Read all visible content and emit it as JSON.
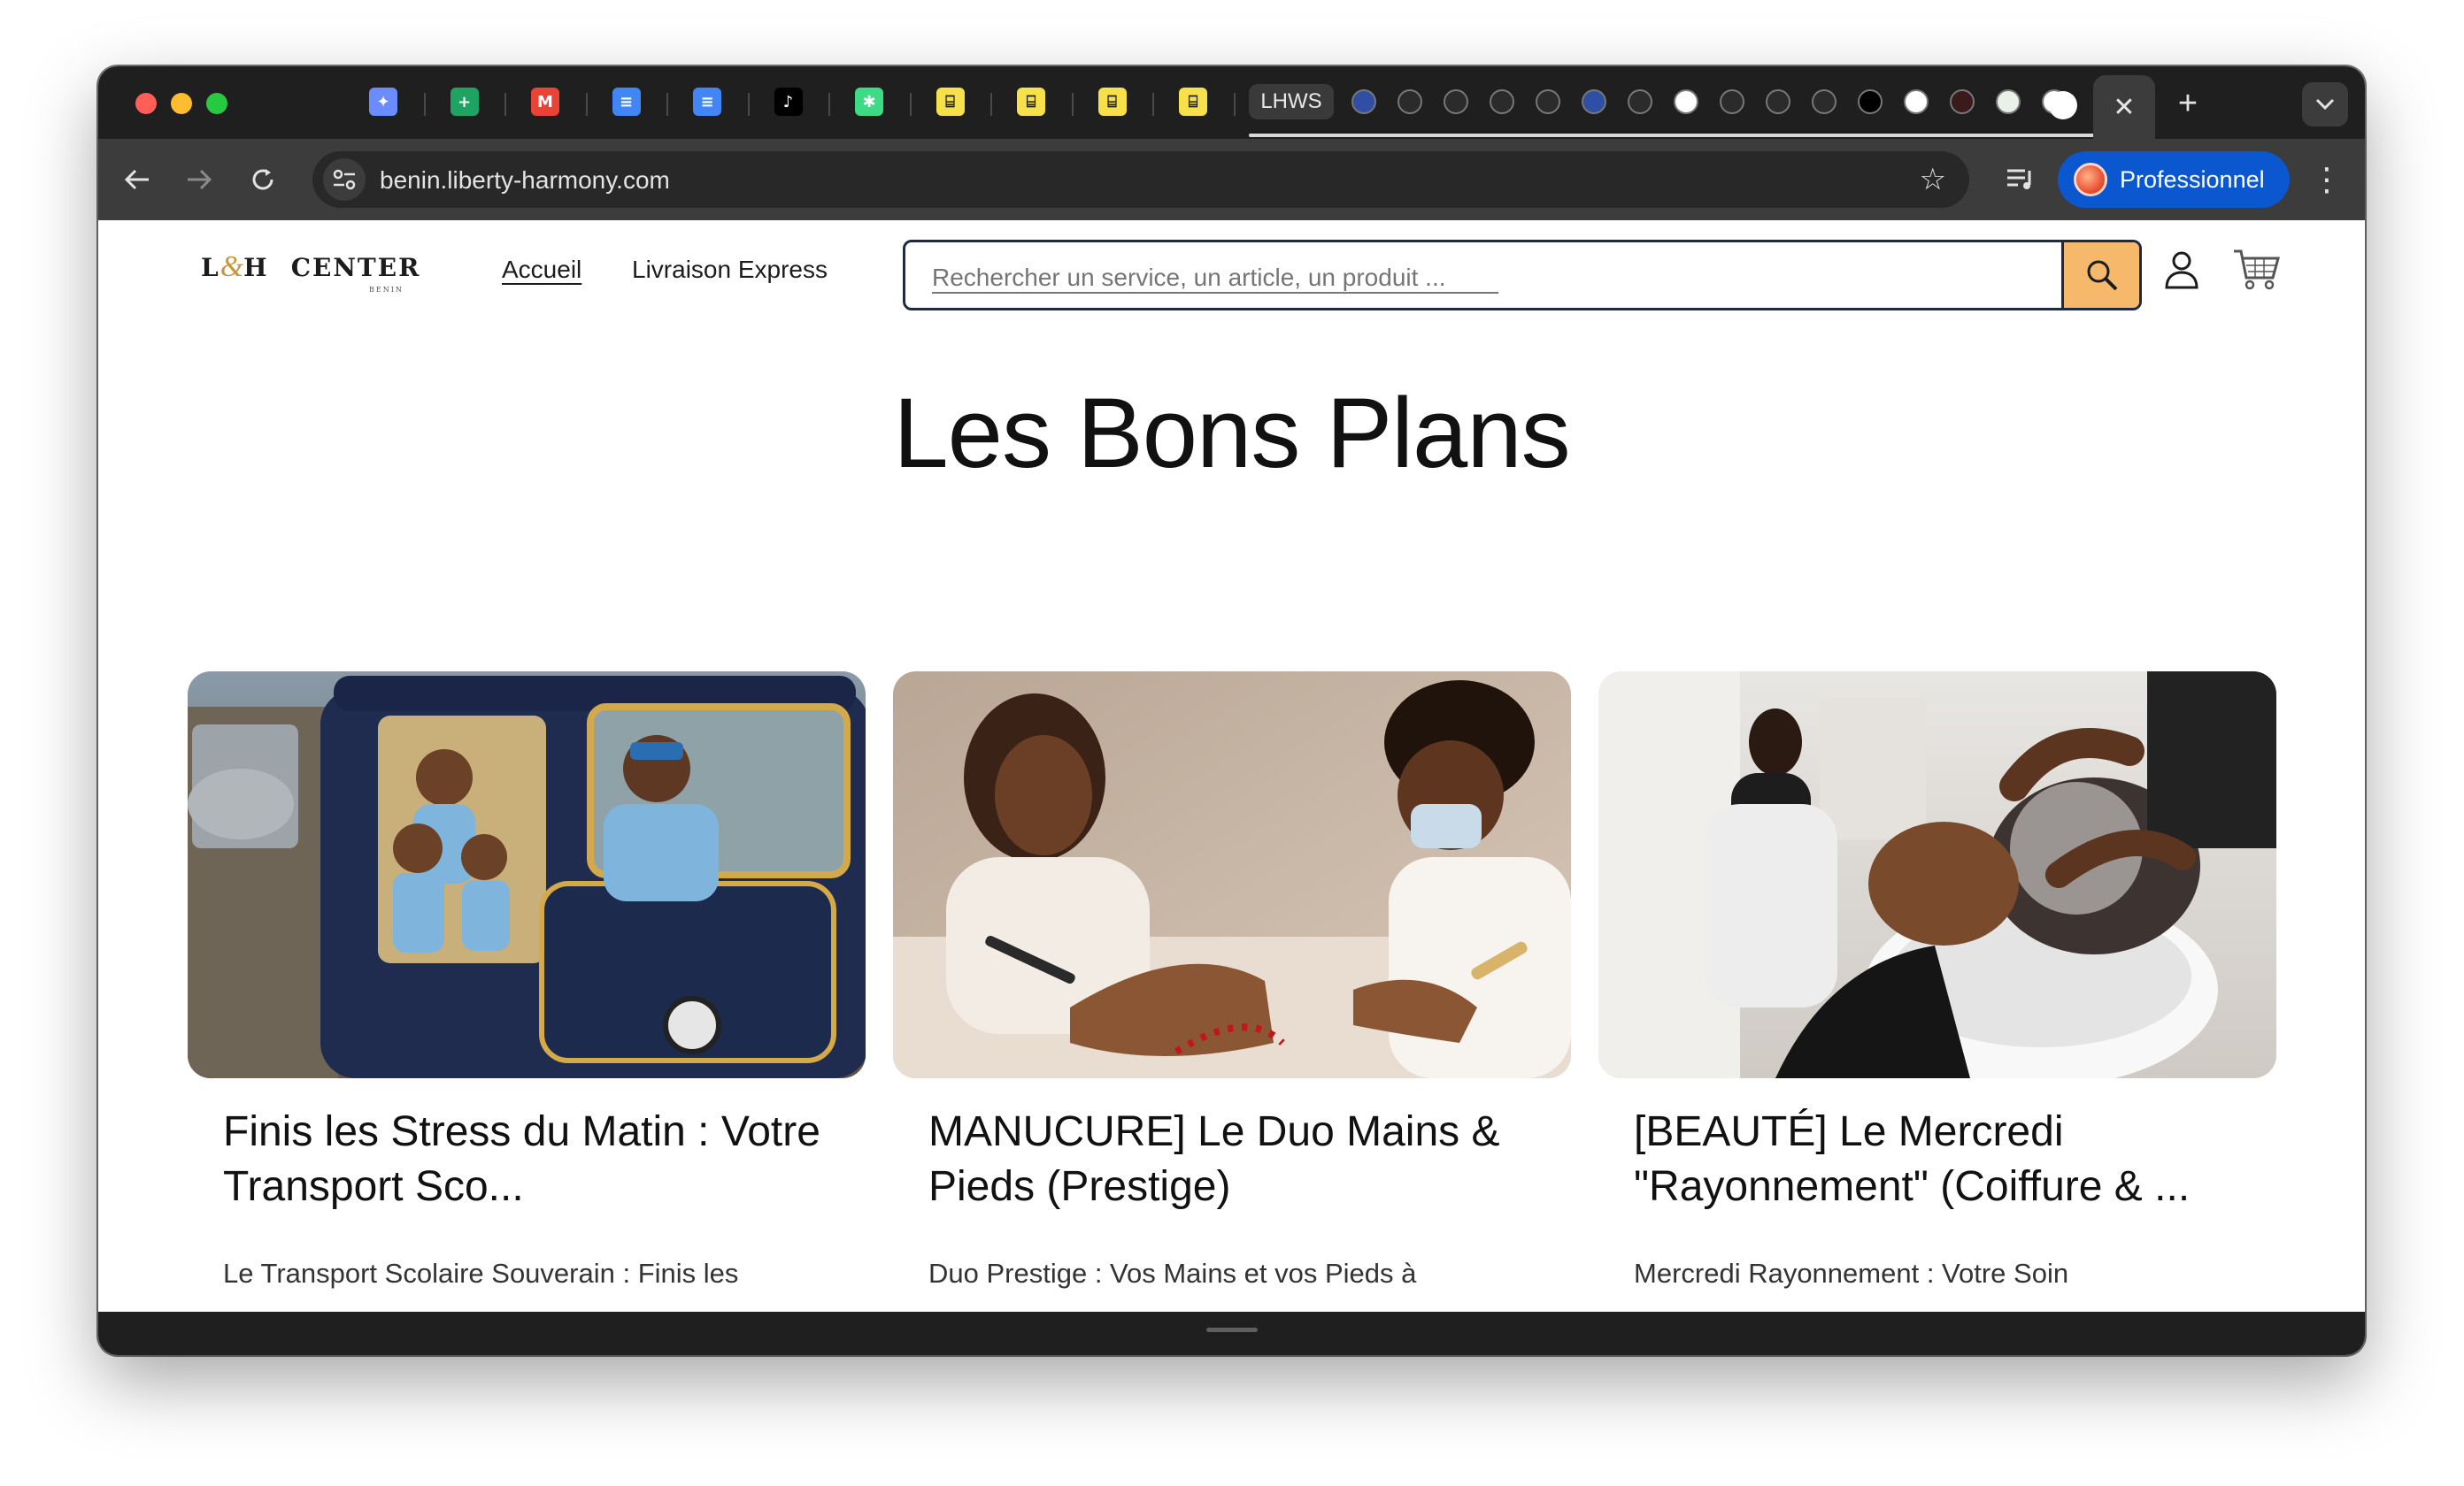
{
  "browser": {
    "tabs": [
      {
        "name": "gemini-tab",
        "icon": "sparkle-icon",
        "color": "#6b8cff",
        "glyph": "✦"
      },
      {
        "name": "sheets-tab",
        "icon": "google-sheets-icon",
        "color": "#1ea362",
        "glyph": "+"
      },
      {
        "name": "gmail-tab",
        "icon": "gmail-icon",
        "color": "#ea4335",
        "glyph": "M"
      },
      {
        "name": "docs-tab-1",
        "icon": "google-docs-icon",
        "color": "#4285f4",
        "glyph": "≡"
      },
      {
        "name": "docs-tab-2",
        "icon": "google-docs-icon",
        "color": "#4285f4",
        "glyph": "≡"
      },
      {
        "name": "tiktok-tab",
        "icon": "tiktok-icon",
        "color": "#000000",
        "glyph": "♪"
      },
      {
        "name": "app-tab",
        "icon": "asterisk-icon",
        "color": "#3ddc84",
        "glyph": "✱"
      },
      {
        "name": "yellow-tab-1",
        "icon": "yellow-app-icon",
        "color": "#f7e14b",
        "glyph": "⌸"
      },
      {
        "name": "yellow-tab-2",
        "icon": "yellow-app-icon",
        "color": "#f7e14b",
        "glyph": "⌸"
      },
      {
        "name": "yellow-tab-3",
        "icon": "yellow-app-icon",
        "color": "#f7e14b",
        "glyph": "⌸"
      },
      {
        "name": "yellow-tab-4",
        "icon": "yellow-app-icon",
        "color": "#f7e14b",
        "glyph": "⌸"
      },
      {
        "name": "yellow-tab-5",
        "icon": "yellow-app-icon",
        "color": "#f7e14b",
        "glyph": "⌸"
      }
    ],
    "group_label": "LHWS",
    "group_tabs": [
      {
        "name": "lh-tab-1",
        "icon": "globe-icon",
        "color": "#2e4fa3"
      },
      {
        "name": "lh-tab-2",
        "icon": "lh-logo-icon",
        "color": "#2b2b2b"
      },
      {
        "name": "lh-tab-3",
        "icon": "lh-logo-icon",
        "color": "#2b2b2b"
      },
      {
        "name": "lh-tab-4",
        "icon": "lh-logo-icon",
        "color": "#2b2b2b"
      },
      {
        "name": "lh-tab-5",
        "icon": "lh-logo-icon",
        "color": "#2b2b2b"
      },
      {
        "name": "lh-tab-6",
        "icon": "globe-icon",
        "color": "#2e4fa3"
      },
      {
        "name": "lh-tab-7",
        "icon": "lh-logo-icon",
        "color": "#2b2b2b"
      },
      {
        "name": "lh-tab-8",
        "icon": "lh-circle-icon",
        "color": "#ffffff"
      },
      {
        "name": "lh-tab-9",
        "icon": "lh-logo-icon",
        "color": "#2b2b2b"
      },
      {
        "name": "lh-tab-10",
        "icon": "lh-logo-icon",
        "color": "#2b2b2b"
      },
      {
        "name": "lh-tab-11",
        "icon": "lh-logo-icon",
        "color": "#2b2b2b"
      },
      {
        "name": "lh-tab-12",
        "icon": "b-logo-icon",
        "color": "#000000"
      },
      {
        "name": "lh-tab-13",
        "icon": "flower-icon",
        "color": "#ffffff"
      },
      {
        "name": "lh-tab-14",
        "icon": "dark-logo-icon",
        "color": "#3a1a1a"
      },
      {
        "name": "lh-tab-15",
        "icon": "picture-icon",
        "color": "#e8f0e8"
      },
      {
        "name": "lh-tab-16",
        "icon": "lh-circle-icon",
        "color": "#ffffff"
      }
    ],
    "active_tab_close": "✕",
    "new_tab": "+",
    "url": "benin.liberty-harmony.com",
    "profile_label": "Professionnel"
  },
  "site": {
    "logo": {
      "left": "L",
      "amp": "&",
      "right": "H",
      "word": "CENTER",
      "sub": "BENIN"
    },
    "nav": [
      {
        "label": "Accueil",
        "active": true
      },
      {
        "label": "Livraison Express",
        "active": false
      }
    ],
    "search_placeholder": "Rechercher un service, un article, un produit ...",
    "accent_color": "#f6b86a"
  },
  "headline": "Les Bons Plans",
  "cards": [
    {
      "title": "Finis les Stress du Matin : Votre Transport Sco...",
      "excerpt": "Le Transport Scolaire Souverain : Finis les",
      "image": "school-tricycle-photo"
    },
    {
      "title": "MANUCURE] Le Duo Mains & Pieds (Prestige)",
      "excerpt": "Duo Prestige : Vos Mains et vos Pieds à",
      "image": "manicure-photo"
    },
    {
      "title": "[BEAUTÉ] Le Mercredi \"Rayonnement\" (Coiffure & ...",
      "excerpt": "Mercredi Rayonnement : Votre Soin",
      "image": "hair-wash-photo"
    }
  ]
}
